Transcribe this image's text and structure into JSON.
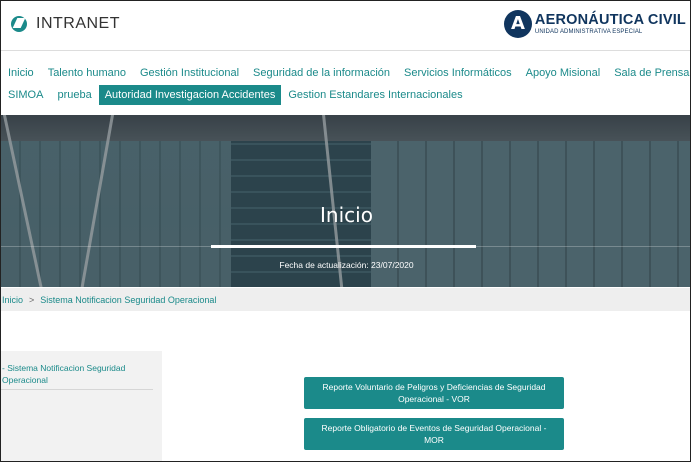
{
  "header": {
    "logo_text": "INTRANET",
    "brand_title": "AERONÁUTICA CIVIL",
    "brand_subtitle": "UNIDAD ADMINISTRATIVA ESPECIAL"
  },
  "nav": {
    "row1": [
      "Inicio",
      "Talento humano",
      "Gestión Institucional",
      "Seguridad de la información",
      "Servicios Informáticos",
      "Apoyo Misional",
      "Sala de Prensa"
    ],
    "row2": [
      "SIMOA",
      "prueba",
      "Autoridad Investigacion Accidentes",
      "Gestion Estandares Internacionales"
    ],
    "active": "Autoridad Investigacion Accidentes"
  },
  "hero": {
    "title": "Inicio",
    "date_text": "Fecha de actualización: 23/07/2020"
  },
  "breadcrumb": {
    "home": "Inicio",
    "separator": ">",
    "current": "Sistema Notificacion Seguridad Operacional"
  },
  "sidebar": {
    "item": "- Sistema Notificacion Seguridad Operacional"
  },
  "buttons": {
    "vor": "Reporte Voluntario de Peligros y Deficiencias de Seguridad Operacional - VOR",
    "mor": "Reporte Obligatorio de Eventos de Seguridad Operacional - MOR"
  },
  "colors": {
    "accent": "#1b8a8a",
    "brand": "#10355e"
  }
}
